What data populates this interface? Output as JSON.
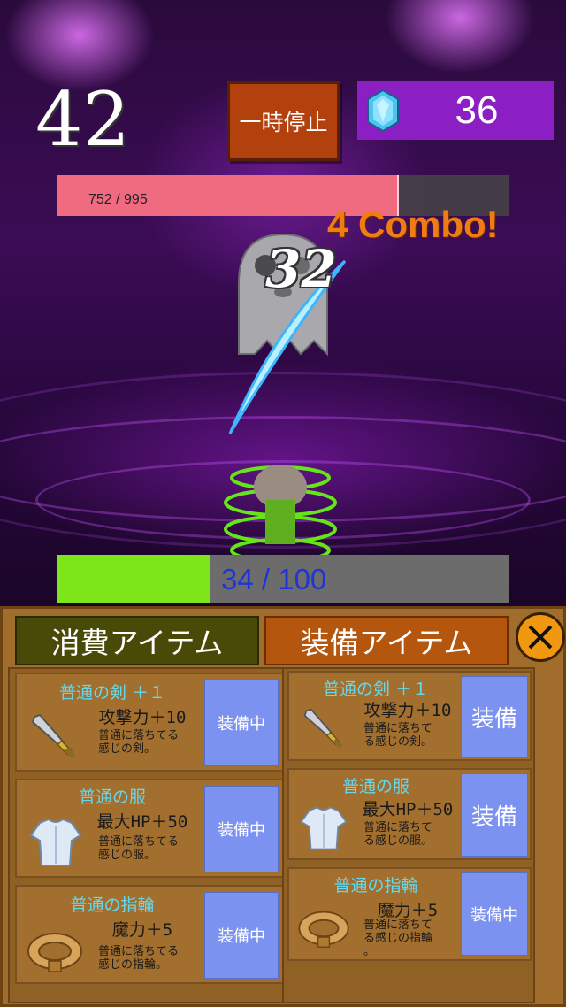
{
  "hud": {
    "time_remaining": "42",
    "pause_label": "一時停止",
    "gem_count": "36",
    "enemy_hp_text": "752  / 995",
    "enemy_hp_ratio": 0.756,
    "combo_text": "4 Combo!",
    "damage_number": "32",
    "player_hp_text": "34   / 100",
    "player_hp_ratio": 0.34
  },
  "inventory": {
    "tabs": [
      {
        "label": "消費アイテム"
      },
      {
        "label": "装備アイテム"
      }
    ],
    "close_icon": "close-icon",
    "left_items": [
      {
        "name": "普通の剣 ＋１",
        "stat": "攻撃力＋10",
        "desc1": "普通に落ちてる",
        "desc2": "感じの剣。",
        "icon": "sword-icon",
        "button": "装備中"
      },
      {
        "name": "普通の服",
        "stat": "最大HP＋50",
        "desc1": "普通に落ちてる",
        "desc2": "感じの服。",
        "icon": "shirt-icon",
        "button": "装備中"
      },
      {
        "name": "普通の指輪",
        "stat": "魔力＋5",
        "desc1": "普通に落ちてる",
        "desc2": "感じの指輪。",
        "icon": "ring-icon",
        "button": "装備中"
      }
    ],
    "right_items": [
      {
        "name": "普通の剣 ＋１",
        "stat": "攻撃力＋10",
        "desc1": "普通に落ちて",
        "desc2": "る感じの剣。",
        "desc3": "",
        "icon": "sword-icon",
        "button": "装備"
      },
      {
        "name": "普通の服",
        "stat": "最大HP＋50",
        "desc1": "普通に落ちて",
        "desc2": "る感じの服。",
        "desc3": "",
        "icon": "shirt-icon",
        "button": "装備"
      },
      {
        "name": "普通の指輪",
        "stat": "魔力＋5",
        "desc1": "普通に落ちて",
        "desc2": "る感じの指輪",
        "desc3": "。",
        "icon": "ring-icon",
        "button": "装備中"
      }
    ]
  },
  "colors": {
    "enemy_hp": "#f06a80",
    "player_hp": "#7ce61a",
    "equip_button": "#7c92f0",
    "item_name": "#63d8ee",
    "combo": "#f07d14"
  }
}
